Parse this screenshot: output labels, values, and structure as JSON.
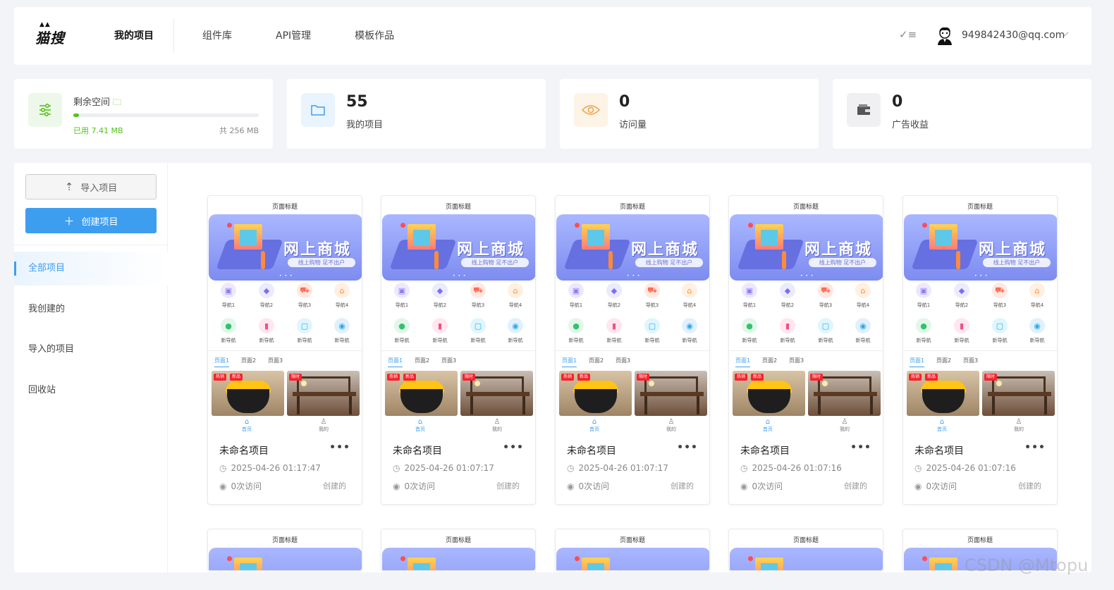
{
  "header": {
    "logo_text": "猫搜",
    "nav": [
      {
        "label": "我的项目",
        "active": true
      },
      {
        "label": "组件库"
      },
      {
        "label": "API管理"
      },
      {
        "label": "模板作品"
      }
    ],
    "check_icon": "check-list-icon",
    "user_email": "949842430@qq.com"
  },
  "stats": {
    "space": {
      "label": "剩余空间",
      "used": "已用 7.41 MB",
      "total": "共 256 MB",
      "used_fraction": 0.029
    },
    "projects": {
      "value": "55",
      "label": "我的项目"
    },
    "visits": {
      "value": "0",
      "label": "访问量"
    },
    "ads": {
      "value": "0",
      "label": "广告收益"
    }
  },
  "sidebar": {
    "import_label": "导入项目",
    "create_label": "创建项目",
    "items": [
      {
        "label": "全部项目",
        "active": true
      },
      {
        "label": "我创建的"
      },
      {
        "label": "导入的项目"
      },
      {
        "label": "回收站"
      }
    ]
  },
  "preview": {
    "page_title": "页面标题",
    "banner_headline": "网上商城",
    "banner_sub": "线上购物 足不出户",
    "nav_icons": [
      "导航1",
      "导航2",
      "导航3",
      "导航4",
      "新导航",
      "新导航",
      "新导航",
      "新导航"
    ],
    "tabs": [
      "页面1",
      "页面2",
      "页面3"
    ],
    "tag_hot": "热销",
    "tag_new": "新品",
    "tag_limited": "限时",
    "tab_home": "首页",
    "tab_me": "我的"
  },
  "projects": [
    {
      "name": "未命名项目",
      "time": "2025-04-26 01:17:47",
      "visits": "0次访问",
      "owner": "创建的"
    },
    {
      "name": "未命名项目",
      "time": "2025-04-26 01:07:17",
      "visits": "0次访问",
      "owner": "创建的"
    },
    {
      "name": "未命名项目",
      "time": "2025-04-26 01:07:17",
      "visits": "0次访问",
      "owner": "创建的"
    },
    {
      "name": "未命名项目",
      "time": "2025-04-26 01:07:16",
      "visits": "0次访问",
      "owner": "创建的"
    },
    {
      "name": "未命名项目",
      "time": "2025-04-26 01:07:16",
      "visits": "0次访问",
      "owner": "创建的"
    }
  ],
  "more_label": "•••",
  "watermark": "CSDN @Mtopu",
  "colors": {
    "accent": "#3d9ef0",
    "success": "#52c41a",
    "tag_red": "#f5222d"
  }
}
